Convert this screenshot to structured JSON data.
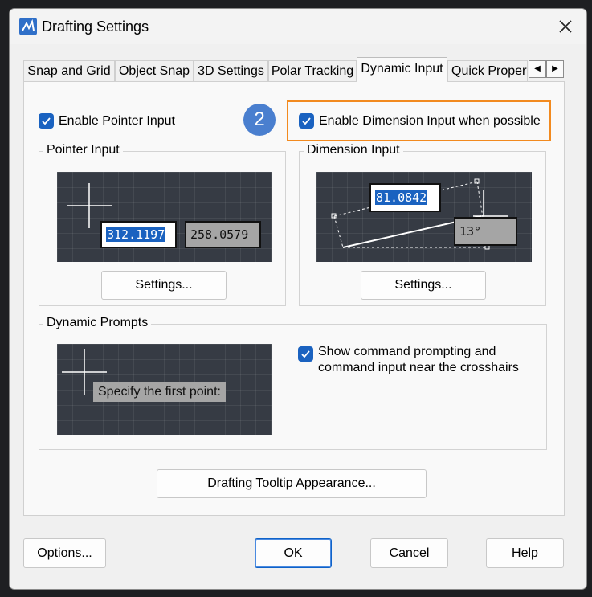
{
  "window": {
    "title": "Drafting Settings"
  },
  "tabs": [
    {
      "label": "Snap and Grid",
      "active": false
    },
    {
      "label": "Object Snap",
      "active": false
    },
    {
      "label": "3D Settings",
      "active": false
    },
    {
      "label": "Polar Tracking",
      "active": false
    },
    {
      "label": "Dynamic Input",
      "active": true
    },
    {
      "label": "Quick Propert",
      "active": false
    }
  ],
  "callout": {
    "number": "2",
    "color": "#4a7fcf",
    "highlight_color": "#f28a1f"
  },
  "pointer": {
    "enable_label": "Enable Pointer Input",
    "enabled": true,
    "group_title": "Pointer Input",
    "value_x": "312.1197",
    "value_y": "258.0579",
    "settings_label": "Settings..."
  },
  "dimension": {
    "enable_label": "Enable Dimension Input when possible",
    "enabled": true,
    "group_title": "Dimension Input",
    "length_value": "81.0842",
    "angle_value": "13°",
    "settings_label": "Settings..."
  },
  "prompts": {
    "group_title": "Dynamic Prompts",
    "preview_text": "Specify the first point:",
    "show_label_line1": "Show command prompting and",
    "show_label_line2": "command input near the crosshairs",
    "enabled": true
  },
  "tooltip_button": "Drafting Tooltip Appearance...",
  "footer": {
    "options": "Options...",
    "ok": "OK",
    "cancel": "Cancel",
    "help": "Help"
  },
  "colors": {
    "accent": "#1a62c0",
    "preview_bg": "#363b44",
    "selection": "#1a62c0"
  }
}
